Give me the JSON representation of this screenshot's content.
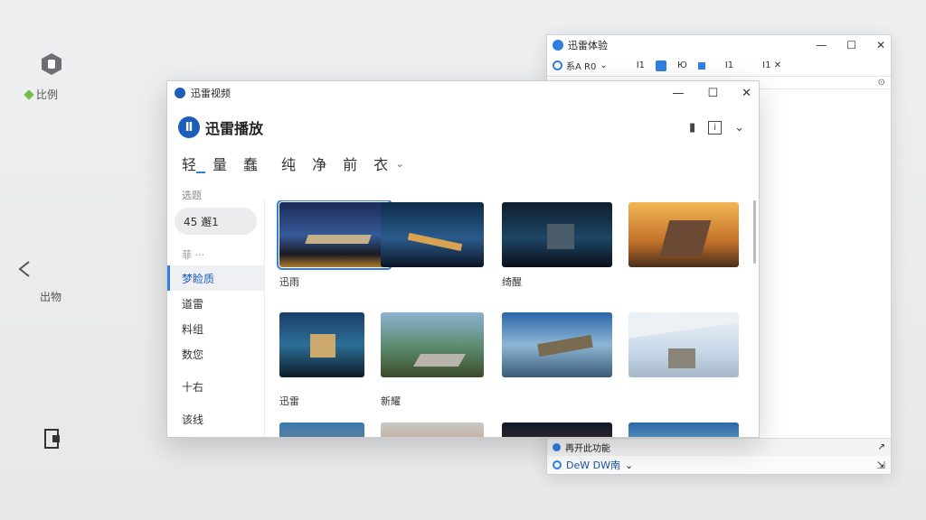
{
  "desktop": {
    "top_label": "比例",
    "mid_label": "出物"
  },
  "bg_window": {
    "title": "迅雷体验",
    "toolbar_left": "系A R0",
    "toolbar_items": [
      "Ι1",
      "Ю",
      "Ι1",
      "Ι1 ✕"
    ],
    "bottom_status": "再开此功能",
    "bottom_label": "DeW  DW南"
  },
  "main_window": {
    "title": "迅雷视频",
    "app_name": "迅雷播放",
    "tabs": [
      "轻",
      "量",
      "蠢",
      "纯",
      "净",
      "前",
      "衣"
    ],
    "sidebar": {
      "caption": "选题",
      "search_value": "45 邂1",
      "more": "菲 ···",
      "items": [
        "梦睑质",
        "道雷",
        "料组",
        "数您",
        "十右",
        "该线"
      ]
    },
    "captions": [
      "迅雨",
      "绮醒",
      "迅雷",
      "新耀"
    ]
  },
  "colors": {
    "accent": "#2f7fe0"
  }
}
